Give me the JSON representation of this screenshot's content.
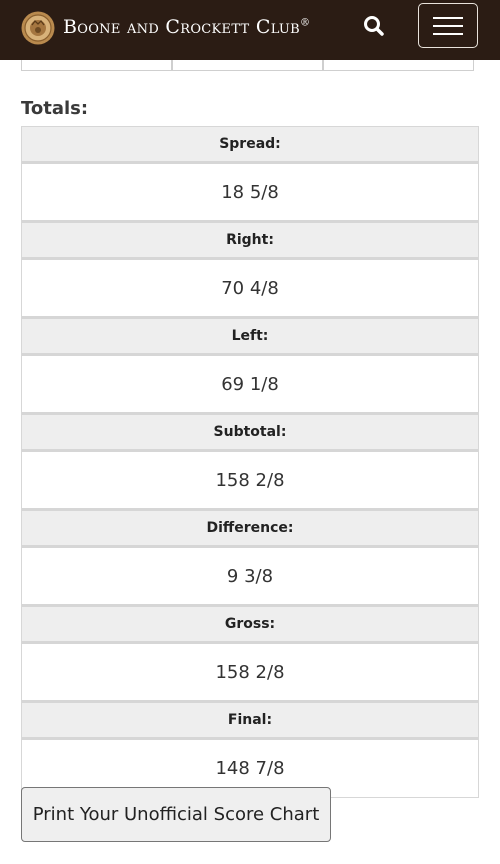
{
  "header": {
    "brand_name": "Boone and Crockett Club",
    "brand_mark": "®",
    "colors": {
      "background": "#2b1c14",
      "text": "#ffffff"
    },
    "icons": {
      "logo": "club-seal-icon",
      "search": "search-icon",
      "menu": "hamburger-menu-icon"
    }
  },
  "totals": {
    "title": "Totals:",
    "rows": [
      {
        "label": "Spread:",
        "value": "18 5/8"
      },
      {
        "label": "Right:",
        "value": "70 4/8"
      },
      {
        "label": "Left:",
        "value": "69 1/8"
      },
      {
        "label": "Subtotal:",
        "value": "158 2/8"
      },
      {
        "label": "Difference:",
        "value": "9 3/8"
      },
      {
        "label": "Gross:",
        "value": "158 2/8"
      },
      {
        "label": "Final:",
        "value": "148 7/8"
      }
    ]
  },
  "actions": {
    "print_label": "Print Your Unofficial Score Chart"
  }
}
